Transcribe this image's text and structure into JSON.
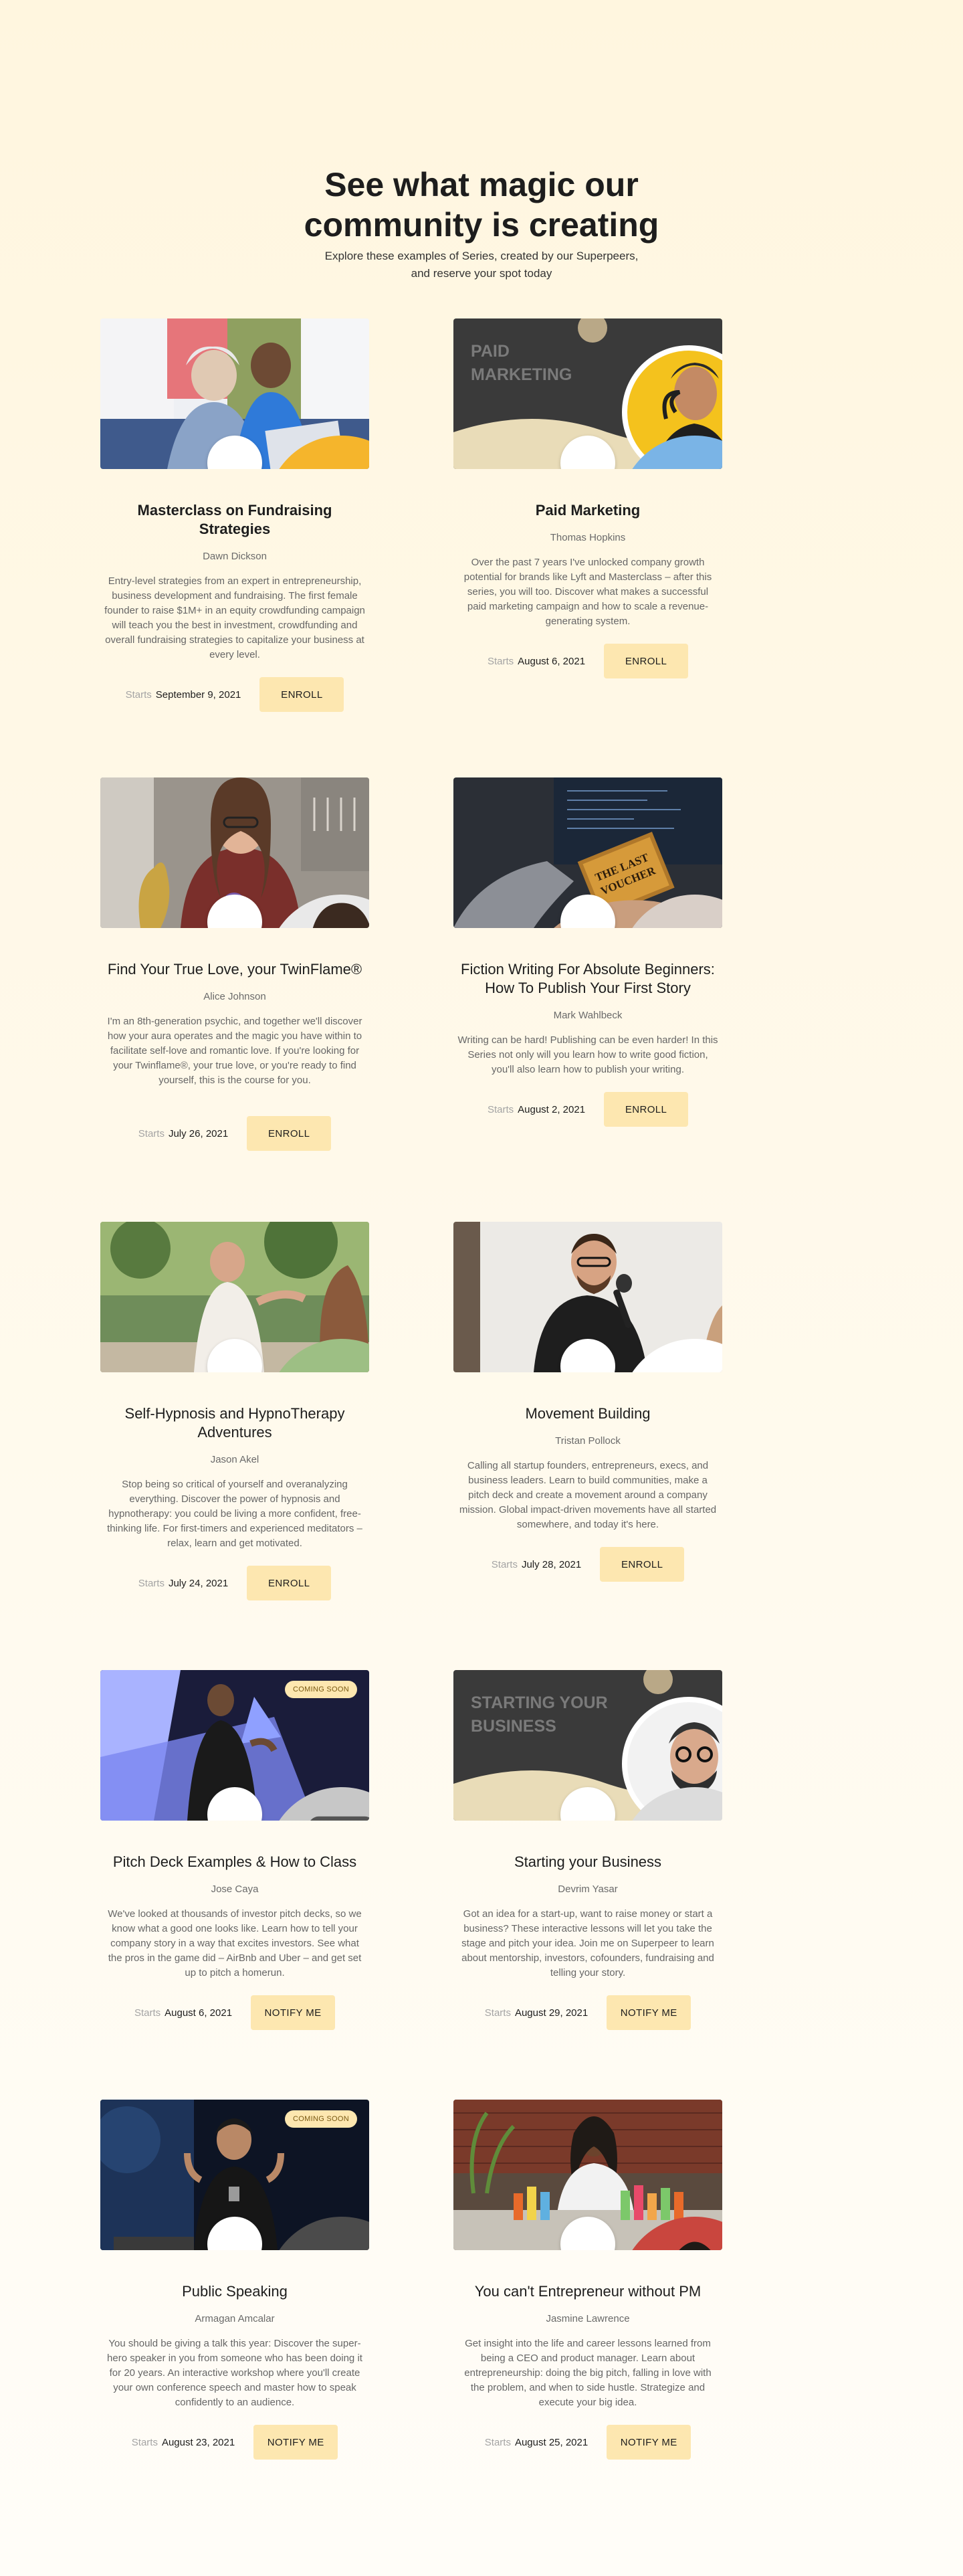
{
  "hero": {
    "title_line1": "See what magic our",
    "title_line2": "community is creating",
    "subtitle_line1": "Explore these examples of Series, created by our Superpeers,",
    "subtitle_line2": "and reserve your spot today"
  },
  "starts_label": "Starts",
  "cards": [
    {
      "title": "Masterclass on Fundraising Strategies",
      "author": "Dawn Dickson",
      "desc": "Entry-level strategies from an expert in entrepreneurship, business development and fundraising. The first female founder to raise $1M+ in an equity crowdfunding campaign will teach you the best in investment, crowdfunding and overall fundraising strategies to capitalize your business at every level.",
      "date": "September 9, 2021",
      "button": "ENROLL"
    },
    {
      "title": "Paid Marketing",
      "author": "Thomas Hopkins",
      "image_text_line1": "PAID",
      "image_text_line2": "MARKETING",
      "desc": "Over the past 7 years I've unlocked company growth potential for brands like Lyft and Masterclass – after this series, you will too. Discover what makes a successful paid marketing campaign and how to scale a revenue-generating system.",
      "date": "August 6, 2021",
      "button": "ENROLL"
    },
    {
      "title": "Find Your True Love, your TwinFlame®",
      "author": "Alice Johnson",
      "desc": "I'm an 8th-generation psychic, and together we'll discover how your aura operates and the magic you have within to facilitate self-love and romantic love. If you're looking for your Twinflame®, your true love, or you're ready to find yourself, this is the course for you.",
      "date": "July 26, 2021",
      "button": "ENROLL"
    },
    {
      "title": "Fiction Writing For Absolute Beginners: How To Publish Your First Story",
      "author": "Mark Wahlbeck",
      "image_text_line1": "THE LAST",
      "image_text_line2": "VOUCHER",
      "desc": "Writing can be hard! Publishing can be even harder! In this Series not only will you learn how to write good fiction, you'll also learn how to publish your writing.",
      "date": "August 2, 2021",
      "button": "ENROLL"
    },
    {
      "title": "Self-Hypnosis and HypnoTherapy Adventures",
      "author": "Jason Akel",
      "desc": "Stop being so critical of yourself and overanalyzing everything. Discover the power of hypnosis and hypnotherapy: you could be living a more confident, free-thinking life. For first-timers and experienced meditators – relax, learn and get motivated.",
      "date": "July 24, 2021",
      "button": "ENROLL"
    },
    {
      "title": "Movement Building",
      "author": "Tristan Pollock",
      "desc": "Calling all startup founders, entrepreneurs, execs, and business leaders. Learn to build communities, make a pitch deck and create a movement around a company mission. Global impact-driven movements have all started somewhere, and today it's here.",
      "date": "July 28, 2021",
      "button": "ENROLL"
    },
    {
      "title": "Pitch Deck Examples & How to Class",
      "author": "Jose Caya",
      "badge": "COMING SOON",
      "desc": "We've looked at thousands of investor pitch decks, so we know what a good one looks like. Learn how to tell your company story in a way that excites investors. See what the pros in the game did – AirBnb and Uber – and get set up to pitch a homerun.",
      "date": "August 6, 2021",
      "button": "NOTIFY ME"
    },
    {
      "title": "Starting your Business",
      "author": "Devrim Yasar",
      "image_text_line1": "STARTING YOUR",
      "image_text_line2": "BUSINESS",
      "desc": "Got an idea for a start-up, want to raise money or start a business? These interactive lessons will let you take the stage and pitch your idea. Join me on Superpeer to learn about mentorship, investors, cofounders, fundraising and telling your story.",
      "date": "August 29, 2021",
      "button": "NOTIFY ME"
    },
    {
      "title": "Public Speaking",
      "author": "Armagan Amcalar",
      "badge": "COMING SOON",
      "desc": "You should be giving a talk this year: Discover the super-hero speaker in you from someone who has been doing it for 20 years. An interactive workshop where you'll create your own conference speech and master how to speak confidently to an audience.",
      "date": "August 23, 2021",
      "button": "NOTIFY ME"
    },
    {
      "title": "You can't Entrepreneur without PM",
      "author": "Jasmine Lawrence",
      "desc": "Get insight into the life and career lessons learned from being a CEO and product manager. Learn about entrepreneurship: doing the big pitch, falling in love with the problem, and when to side hustle. Strategize and execute your big idea.",
      "date": "August 25, 2021",
      "button": "NOTIFY ME"
    }
  ]
}
